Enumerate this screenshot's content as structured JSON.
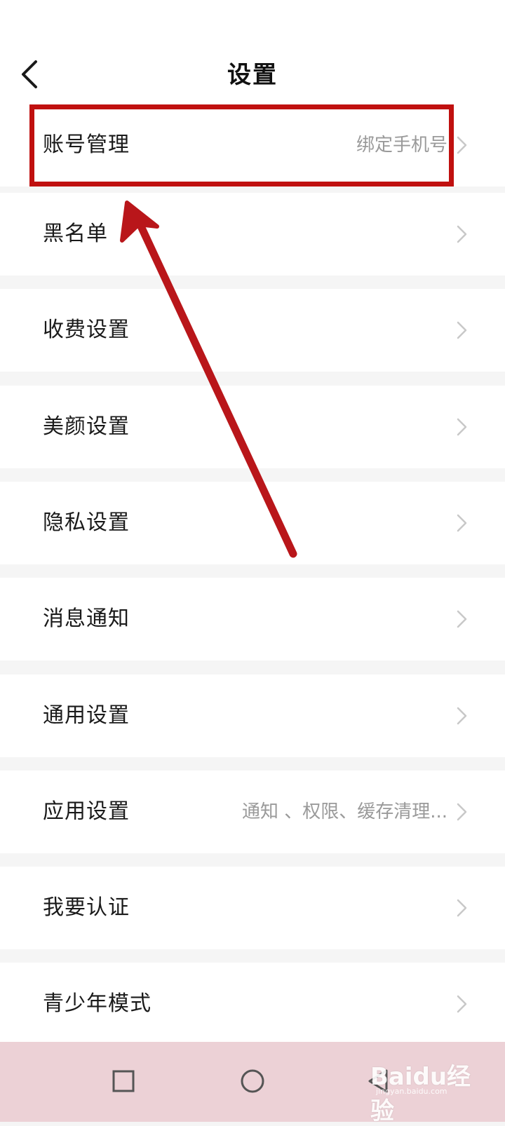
{
  "header": {
    "title": "设置",
    "back_icon": "chevron-left-icon"
  },
  "settings": [
    {
      "label": "账号管理",
      "value": "绑定手机号"
    },
    {
      "label": "黑名单",
      "value": ""
    },
    {
      "label": "收费设置",
      "value": ""
    },
    {
      "label": "美颜设置",
      "value": ""
    },
    {
      "label": "隐私设置",
      "value": ""
    },
    {
      "label": "消息通知",
      "value": ""
    },
    {
      "label": "通用设置",
      "value": ""
    },
    {
      "label": "应用设置",
      "value": "通知 、权限、缓存清理..."
    },
    {
      "label": "我要认证",
      "value": ""
    },
    {
      "label": "青少年模式",
      "value": ""
    }
  ],
  "nav": {
    "recent_icon": "square-icon",
    "home_icon": "circle-icon",
    "back_icon": "triangle-back-icon"
  },
  "watermark": {
    "brand": "Baidu经验",
    "site": "jingyan.baidu.com"
  },
  "colors": {
    "annotation_red": "#c0100f",
    "nav_bar": "#ecd1d6",
    "divider": "#f5f5f5"
  }
}
